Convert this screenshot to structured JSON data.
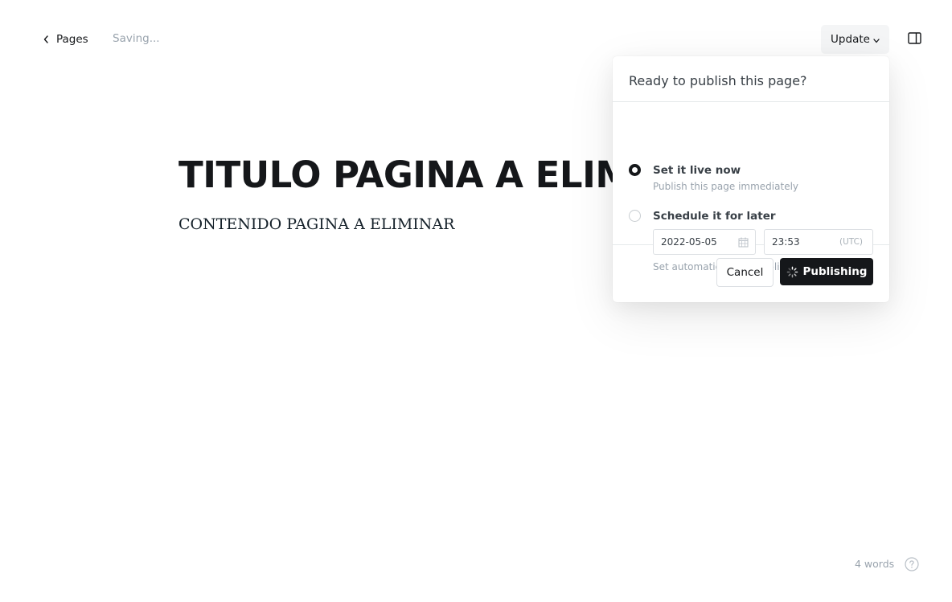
{
  "header": {
    "back_label": "Pages",
    "status": "Saving...",
    "update_label": "Update",
    "icons": {
      "back": "chevron-left-icon",
      "update_dropdown": "chevron-down-icon",
      "sidebar": "sidebar-toggle-icon"
    }
  },
  "editor": {
    "title": "TITULO PAGINA A ELIMINAR",
    "body": "CONTENIDO PAGINA A ELIMINAR"
  },
  "publish_menu": {
    "heading": "Ready to publish this page?",
    "options": [
      {
        "title": "Set it live now",
        "description": "Publish this page immediately",
        "selected": true
      },
      {
        "title": "Schedule it for later",
        "description": "Set automatic future publish date",
        "selected": false
      }
    ],
    "date_value": "2022-05-05",
    "time_value": "23:53",
    "timezone": "(UTC)",
    "cancel_label": "Cancel",
    "publish_label": "Publishing",
    "icons": {
      "date": "calendar-icon",
      "publish": "spinner-icon"
    }
  },
  "footer": {
    "word_count": "4 words",
    "help_icon": "help-icon"
  },
  "colors": {
    "primary_button": "#15171a",
    "muted_text": "#99a3ad",
    "border": "#dcdfe3",
    "update_button_bg": "#f4f5f6"
  }
}
